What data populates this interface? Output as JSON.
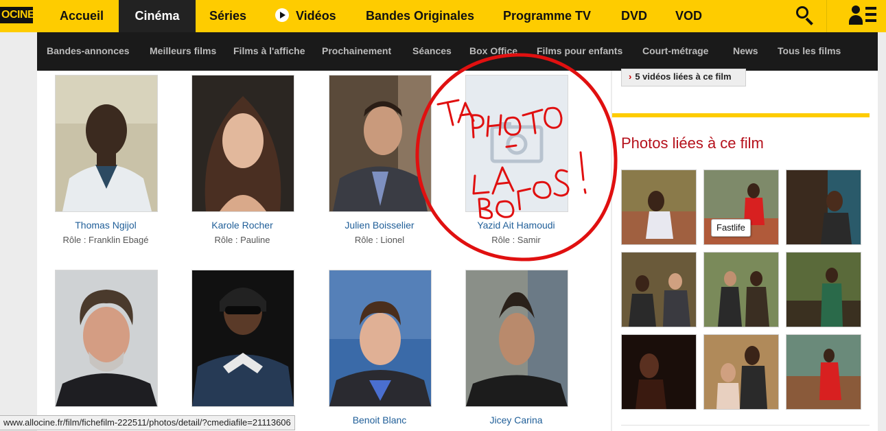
{
  "brand": {
    "logo_text": "OCINE"
  },
  "top_nav": {
    "items": [
      {
        "label": "Accueil"
      },
      {
        "label": "Cinéma"
      },
      {
        "label": "Séries"
      },
      {
        "label": "Vidéos"
      },
      {
        "label": "Bandes Originales"
      },
      {
        "label": "Programme TV"
      },
      {
        "label": "DVD"
      },
      {
        "label": "VOD"
      }
    ],
    "active": "Cinéma"
  },
  "sub_nav": {
    "items": [
      {
        "label": "Bandes-annonces"
      },
      {
        "label": "Meilleurs films"
      },
      {
        "label": "Films à l'affiche"
      },
      {
        "label": "Prochainement"
      },
      {
        "label": "Séances"
      },
      {
        "label": "Box Office"
      },
      {
        "label": "Films pour enfants"
      },
      {
        "label": "Court-métrage"
      },
      {
        "label": "News"
      },
      {
        "label": "Tous les films"
      }
    ]
  },
  "cast": [
    {
      "name": "Thomas Ngijol",
      "role": "Rôle : Franklin Ebagé"
    },
    {
      "name": "Karole Rocher",
      "role": "Rôle : Pauline"
    },
    {
      "name": "Julien Boisselier",
      "role": "Rôle : Lionel"
    },
    {
      "name": "Yazid Ait Hamoudi",
      "role": "Rôle : Samir"
    },
    {
      "name": "",
      "role": ""
    },
    {
      "name": "",
      "role": ""
    },
    {
      "name": "Benoit Blanc",
      "role": ""
    },
    {
      "name": "Jicey Carina",
      "role": ""
    }
  ],
  "sidebar": {
    "videos_button": "5 vidéos liées à ce film",
    "photos_title": "Photos liées à ce film",
    "tooltip": "Fastlife"
  },
  "status_bar": {
    "url": "www.allocine.fr/film/fichefilm-222511/photos/detail/?cmediafile=21113606"
  },
  "annotation": {
    "lines": [
      "TA",
      "PHOTO",
      "LA",
      "BOLOS!"
    ]
  },
  "colors": {
    "brand_yellow": "#fecc00",
    "nav_dark": "#1a1a1a",
    "link_blue": "#1f5e98",
    "title_red": "#b5101b",
    "annotation_red": "#e01010"
  }
}
